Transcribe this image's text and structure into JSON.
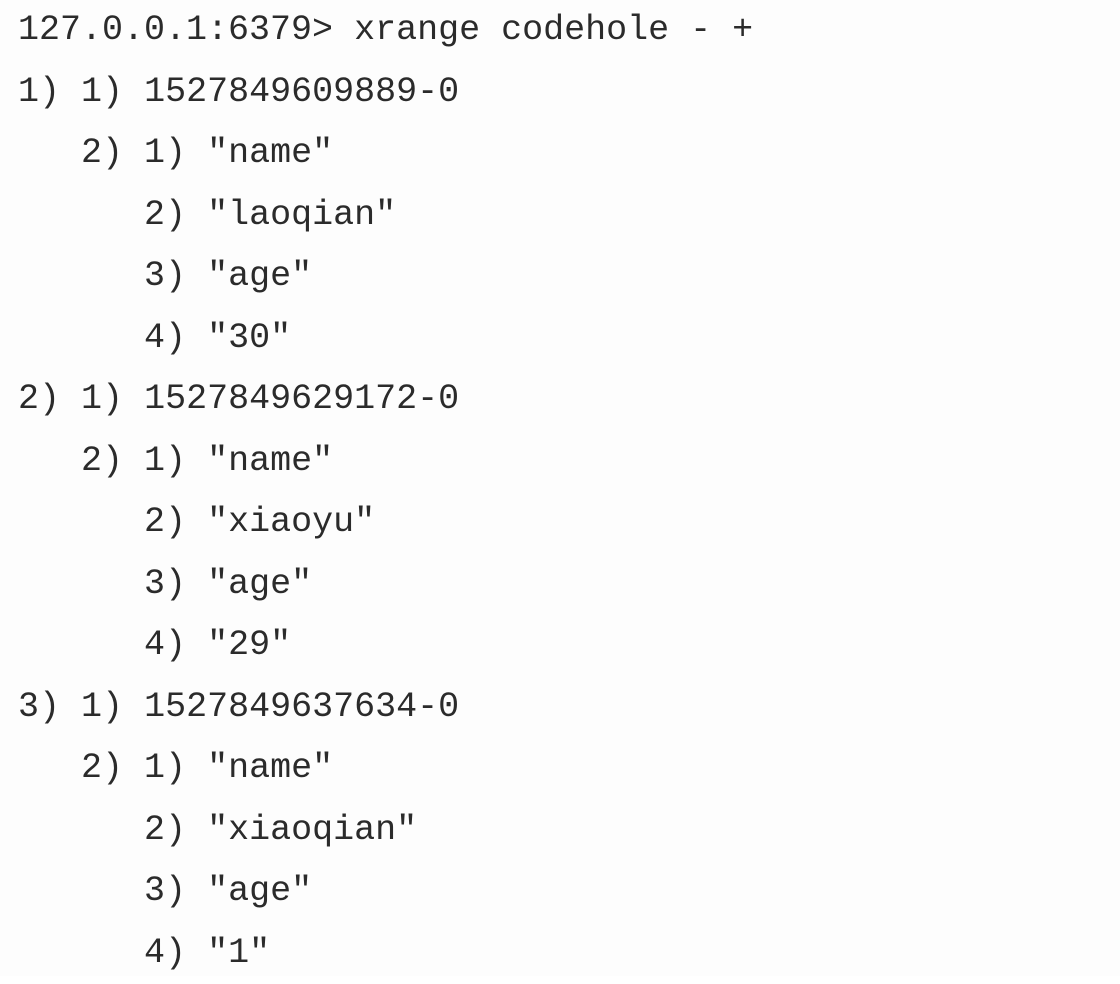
{
  "terminal": {
    "prompt": "127.0.0.1:6379>",
    "command": "xrange codehole - +",
    "entries": [
      {
        "index": "1)",
        "id_index": "1)",
        "id": "1527849609889-0",
        "fields_index": "2)",
        "fields": [
          {
            "index": "1)",
            "value": "\"name\""
          },
          {
            "index": "2)",
            "value": "\"laoqian\""
          },
          {
            "index": "3)",
            "value": "\"age\""
          },
          {
            "index": "4)",
            "value": "\"30\""
          }
        ]
      },
      {
        "index": "2)",
        "id_index": "1)",
        "id": "1527849629172-0",
        "fields_index": "2)",
        "fields": [
          {
            "index": "1)",
            "value": "\"name\""
          },
          {
            "index": "2)",
            "value": "\"xiaoyu\""
          },
          {
            "index": "3)",
            "value": "\"age\""
          },
          {
            "index": "4)",
            "value": "\"29\""
          }
        ]
      },
      {
        "index": "3)",
        "id_index": "1)",
        "id": "1527849637634-0",
        "fields_index": "2)",
        "fields": [
          {
            "index": "1)",
            "value": "\"name\""
          },
          {
            "index": "2)",
            "value": "\"xiaoqian\""
          },
          {
            "index": "3)",
            "value": "\"age\""
          },
          {
            "index": "4)",
            "value": "\"1\""
          }
        ]
      }
    ]
  }
}
